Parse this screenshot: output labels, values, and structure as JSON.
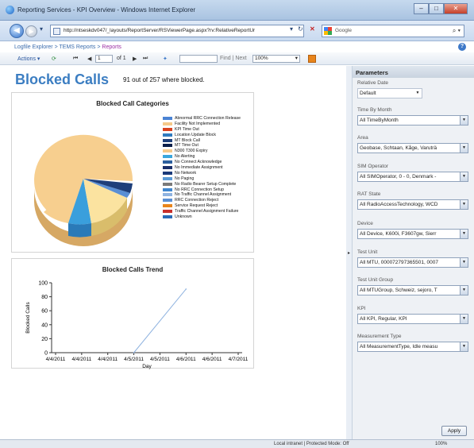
{
  "window": {
    "title": "Reporting Services - KPI Overview - Windows Internet Explorer"
  },
  "address_bar": {
    "url": "http://ntseskdv047/_layouts/ReportServer/RSViewerPage.aspx?rv:RelativeReportUr",
    "search_placeholder": "Google"
  },
  "breadcrumb": {
    "items": [
      "Logfile Explorer",
      "TEMS Reports",
      "Reports"
    ],
    "separator": ">"
  },
  "toolbar": {
    "actions_label": "Actions",
    "page_current": "1",
    "page_of": "of 1",
    "find_next_label": "Find | Next",
    "zoom": "100%"
  },
  "report": {
    "title": "Blocked Calls",
    "summary": "91 out of 257 where blocked."
  },
  "pie_chart": {
    "title": "Blocked Call Categories",
    "legend": [
      {
        "label": "Abnormal RRC Connection Release",
        "color": "#4a83d4"
      },
      {
        "label": "Facility Not Implemented",
        "color": "#f5c98a"
      },
      {
        "label": "KPI Time Out",
        "color": "#d9411e"
      },
      {
        "label": "Location Update Block",
        "color": "#2f7bbf"
      },
      {
        "label": "MT Block Call",
        "color": "#1e3f7a"
      },
      {
        "label": "MT Time Out",
        "color": "#0b1f4a"
      },
      {
        "label": "N300 T300 Expiry",
        "color": "#f5c98a"
      },
      {
        "label": "No Alerting",
        "color": "#3aa6dd"
      },
      {
        "label": "No Connect Acknowledge",
        "color": "#2c5f9e"
      },
      {
        "label": "No Immediate Assignment",
        "color": "#1a2f6a"
      },
      {
        "label": "No Network",
        "color": "#1a3a7a"
      },
      {
        "label": "No Paging",
        "color": "#5a9ad6"
      },
      {
        "label": "No Radio Bearer Setup Complete",
        "color": "#7a7a7a"
      },
      {
        "label": "No RRC Connection Setup",
        "color": "#3f86cf"
      },
      {
        "label": "No Traffic Channel Assignment",
        "color": "#8fb3e0"
      },
      {
        "label": "RRC Connection Reject",
        "color": "#5a8fd4"
      },
      {
        "label": "Service Request Reject",
        "color": "#e8851c"
      },
      {
        "label": "Traffic Channel Assignment Failure",
        "color": "#c9302c"
      },
      {
        "label": "Unknown",
        "color": "#2a6cb8"
      }
    ]
  },
  "chart_data": {
    "type": "line",
    "title": "Blocked Calls Trend",
    "xlabel": "Day",
    "ylabel": "Blocked Calls",
    "x": [
      "4/4/2011",
      "4/4/2011",
      "4/4/2011",
      "4/5/2011",
      "4/5/2011",
      "4/6/2011",
      "4/6/2011",
      "4/7/2011"
    ],
    "yticks": [
      0,
      20,
      40,
      60,
      80,
      100
    ],
    "ylim": [
      0,
      100
    ],
    "series": [
      {
        "x_index": [
          3,
          5
        ],
        "values": [
          0,
          91
        ],
        "color": "#8fb3e0"
      }
    ],
    "grid": false
  },
  "parameters": {
    "header": "Parameters",
    "apply_label": "Apply",
    "fields": [
      {
        "label": "Relative Date",
        "value": "Default"
      },
      {
        "label": "Time By Month",
        "value": "All TimeByMonth"
      },
      {
        "label": "Area",
        "value": "Geobase, Schtaan, Kåge, Varuträ"
      },
      {
        "label": "SIM Operator",
        "value": "All SIMOperator, 0 - 0, Denmark -"
      },
      {
        "label": "RAT State",
        "value": "All RadioAccessTechnology, WCD"
      },
      {
        "label": "Device",
        "value": "All Device, K600i, F3607gw, Sierr"
      },
      {
        "label": "Test Unit",
        "value": "All MTU, 000072797365501, 0007"
      },
      {
        "label": "Test Unit Group",
        "value": "All MTUGroup, Schweiz, sejoro, T"
      },
      {
        "label": "KPI",
        "value": "All KPI, Regular, KPI"
      },
      {
        "label": "Measurement Type",
        "value": "All MeasurementType, Idle measu"
      }
    ]
  },
  "status_bar": {
    "zone": "Local intranet | Protected Mode: Off",
    "zoom": "100%"
  }
}
